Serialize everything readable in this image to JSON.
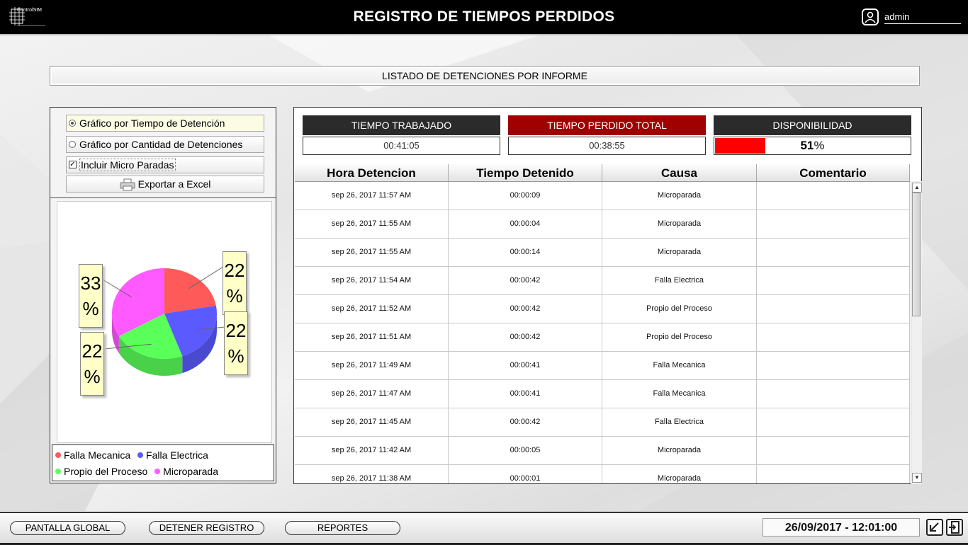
{
  "header": {
    "logo_text": "ControlSIM",
    "title": "REGISTRO DE TIEMPOS PERDIDOS",
    "user": "admin"
  },
  "report_title": "LISTADO DE DETENCIONES POR INFORME",
  "options": {
    "by_time": "Gráfico por Tiempo de Detención",
    "by_count": "Gráfico por Cantidad de Detenciones",
    "include_micro": "Incluir Micro Paradas",
    "export": "Exportar a Excel"
  },
  "chart_data": {
    "type": "pie",
    "slices": [
      {
        "name": "Falla Mecanica",
        "value": 22,
        "label": "22 %",
        "color": "#ff5a5a"
      },
      {
        "name": "Falla Electrica",
        "value": 22,
        "label": "22 %",
        "color": "#5a5aff"
      },
      {
        "name": "Propio del Proceso",
        "value": 22,
        "label": "22 %",
        "color": "#5aff5a"
      },
      {
        "name": "Microparada",
        "value": 33,
        "label": "33 %",
        "color": "#ff5aff"
      }
    ],
    "legend_position": "bottom"
  },
  "kpis": {
    "worked_label": "TIEMPO TRABAJADO",
    "worked_value": "00:41:05",
    "lost_label": "TIEMPO PERDIDO TOTAL",
    "lost_value": "00:38:55",
    "availability_label": "DISPONIBILIDAD",
    "availability_value": "51",
    "availability_unit": "%",
    "availability_fraction": 0.51,
    "colors": {
      "dark": "#2b2b2b",
      "lost": "#a00000",
      "fill": "#ff0000"
    }
  },
  "table": {
    "headers": [
      "Hora Detencion",
      "Tiempo Detenido",
      "Causa",
      "Comentario"
    ],
    "rows": [
      [
        "sep 26, 2017 11:57 AM",
        "00:00:09",
        "Microparada",
        ""
      ],
      [
        "sep 26, 2017 11:55 AM",
        "00:00:04",
        "Microparada",
        ""
      ],
      [
        "sep 26, 2017 11:55 AM",
        "00:00:14",
        "Microparada",
        ""
      ],
      [
        "sep 26, 2017 11:54 AM",
        "00:00:42",
        "Falla Electrica",
        ""
      ],
      [
        "sep 26, 2017 11:52 AM",
        "00:00:42",
        "Propio del Proceso",
        ""
      ],
      [
        "sep 26, 2017 11:51 AM",
        "00:00:42",
        "Propio del Proceso",
        ""
      ],
      [
        "sep 26, 2017 11:49 AM",
        "00:00:41",
        "Falla Mecanica",
        ""
      ],
      [
        "sep 26, 2017 11:47 AM",
        "00:00:41",
        "Falla Mecanica",
        ""
      ],
      [
        "sep 26, 2017 11:45 AM",
        "00:00:42",
        "Falla Electrica",
        ""
      ],
      [
        "sep 26, 2017 11:42 AM",
        "00:00:05",
        "Microparada",
        ""
      ],
      [
        "sep 26, 2017 11:38 AM",
        "00:00:01",
        "Microparada",
        ""
      ]
    ]
  },
  "footer": {
    "global_btn": "PANTALLA GLOBAL",
    "stop_btn": "DETENER REGISTRO",
    "reports_btn": "REPORTES",
    "datetime": "26/09/2017 - 12:01:00"
  },
  "icons": {
    "user": "user-icon",
    "printer": "printer-icon",
    "minimize": "minimize-icon",
    "exit": "exit-icon"
  }
}
